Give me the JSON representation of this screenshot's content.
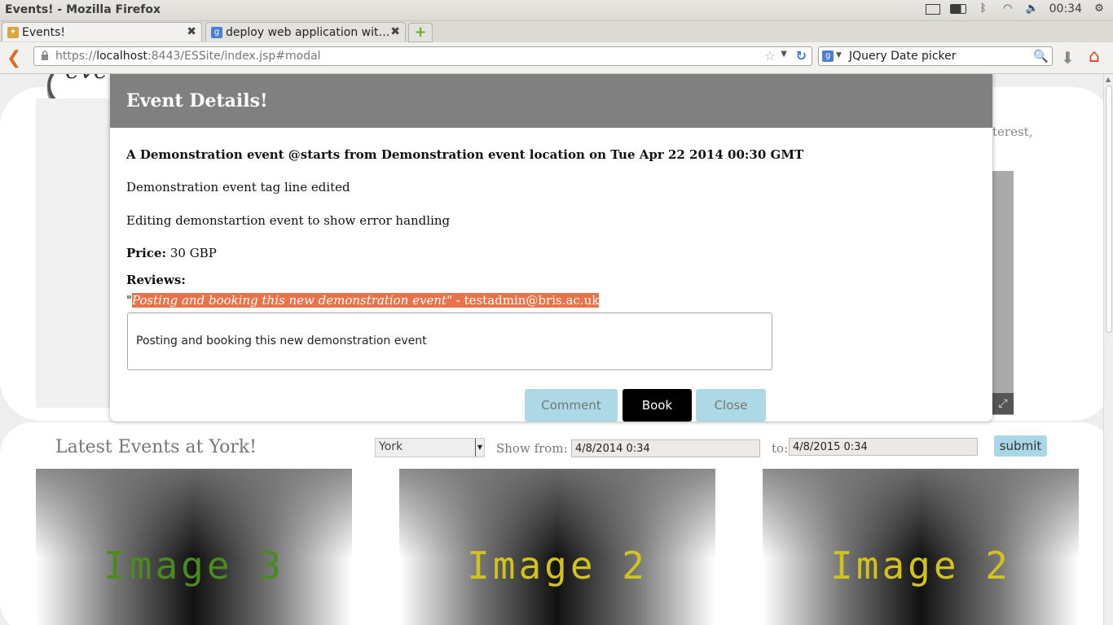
{
  "os": {
    "window_title": "Events! - Mozilla Firefox",
    "clock": "00:34"
  },
  "tabs": [
    {
      "label": "Events!"
    },
    {
      "label": "deploy web application wit…"
    }
  ],
  "nav": {
    "url_prefix": "https://",
    "url_host": "localhost",
    "url_rest": ":8443/ESSite/index.jsp#modal",
    "search_value": "JQuery Date picker"
  },
  "page": {
    "logo_text": "eve",
    "right_partial_text": "terest,",
    "latest_title": "Latest Events at York!",
    "city_selected": "York",
    "show_from_label": "Show from:",
    "from_value": "4/8/2014 0:34",
    "to_label": "to:",
    "to_value": "4/8/2015 0:34",
    "submit_label": "submit",
    "images": [
      {
        "label": "Image 3",
        "color": "#4a8a1e"
      },
      {
        "label": "Image 2",
        "color": "#d2c21e"
      },
      {
        "label": "Image 2",
        "color": "#d2c21e"
      }
    ]
  },
  "modal": {
    "title": "Event Details!",
    "summary": "A Demonstration event @starts from Demonstration event location on Tue Apr 22 2014 00:30 GMT",
    "tagline": "Demonstration event tag line edited",
    "description": "Editing demonstartion event to show error handling",
    "price_label": "Price:",
    "price_value": "30 GBP",
    "reviews_label": "Reviews:",
    "review_open_quote": "\"",
    "review_text": "Posting and booking this new demonstration event",
    "review_author": "\" - testadmin@bris.ac.uk",
    "review_input_value": "Posting and booking this new demonstration event",
    "buttons": {
      "comment": "Comment",
      "book": "Book",
      "close": "Close"
    }
  },
  "colors": {
    "modal_header": "#808080",
    "review_highlight": "#e8734a",
    "button_light": "#add8e6",
    "button_book": "#000000"
  }
}
